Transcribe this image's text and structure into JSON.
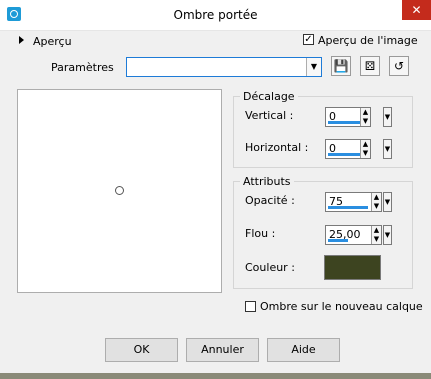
{
  "window": {
    "title": "Ombre portée",
    "close_glyph": "✕"
  },
  "preview_toggle": {
    "label": "Aperçu"
  },
  "preview_checkbox": {
    "label": "Aperçu de l'image",
    "checked": true,
    "check_glyph": "✓"
  },
  "presets": {
    "label": "Paramètres",
    "value": "",
    "dropdown_glyph": "▼"
  },
  "toolbar_icons": [
    "save-icon",
    "dice-icon",
    "reset-icon"
  ],
  "offset_group": {
    "title": "Décalage",
    "vertical": {
      "label": "Vertical :",
      "value": "0"
    },
    "horizontal": {
      "label": "Horizontal :",
      "value": "0"
    }
  },
  "attributes_group": {
    "title": "Attributs",
    "opacity": {
      "label": "Opacité :",
      "value": "75"
    },
    "blur": {
      "label": "Flou :",
      "value": "25,00"
    },
    "color": {
      "label": "Couleur :",
      "value": "#3d4420"
    }
  },
  "new_layer_checkbox": {
    "label": "Ombre sur le nouveau calque",
    "checked": false
  },
  "buttons": {
    "ok": "OK",
    "cancel": "Annuler",
    "help": "Aide"
  },
  "accent_color": "#1e7bd7"
}
